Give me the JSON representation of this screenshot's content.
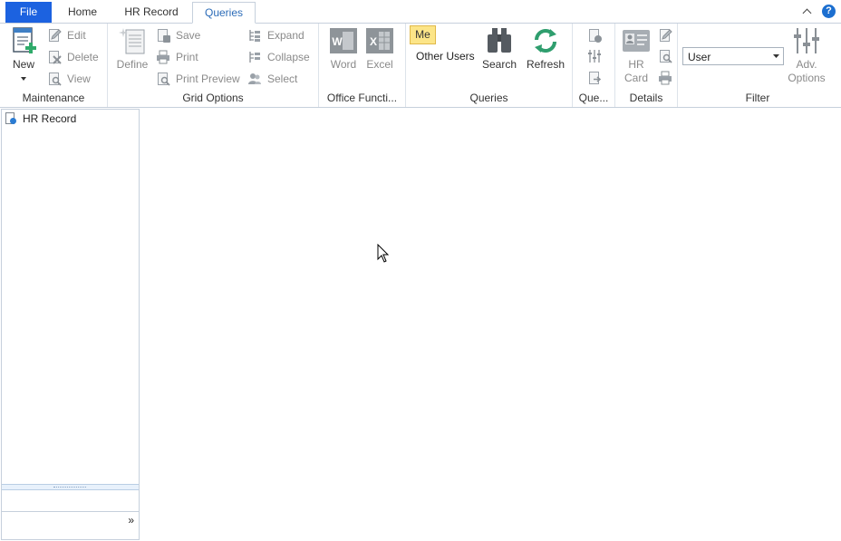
{
  "tabs": [
    {
      "label": "File"
    },
    {
      "label": "Home"
    },
    {
      "label": "HR Record"
    },
    {
      "label": "Queries"
    }
  ],
  "ribbon": {
    "maintenance": {
      "label": "Maintenance",
      "new": "New",
      "edit": "Edit",
      "delete": "Delete",
      "view": "View"
    },
    "grid_options": {
      "label": "Grid Options",
      "define": "Define",
      "save": "Save",
      "print": "Print",
      "print_preview": "Print Preview",
      "expand": "Expand",
      "collapse": "Collapse",
      "select": "Select"
    },
    "office": {
      "label": "Office Functi...",
      "word": "Word",
      "excel": "Excel",
      "word_glyph": "W",
      "excel_glyph": "X"
    },
    "queries": {
      "label": "Queries",
      "me": "Me",
      "other_users": "Other Users",
      "search": "Search",
      "refresh": "Refresh"
    },
    "que": {
      "label": "Que..."
    },
    "details": {
      "label": "Details",
      "hr_card_line1": "HR",
      "hr_card_line2": "Card"
    },
    "filter": {
      "label": "Filter",
      "select_value": "User",
      "adv_line1": "Adv.",
      "adv_line2": "Options"
    }
  },
  "left_panel": {
    "tree": [
      {
        "label": "HR Record"
      }
    ],
    "more_glyph": "»"
  },
  "colors": {
    "file_tab": "#1c62e0",
    "active_tab_text": "#2c6cb8",
    "me_highlight": "#fce588",
    "refresh_green": "#2f9e6e"
  }
}
